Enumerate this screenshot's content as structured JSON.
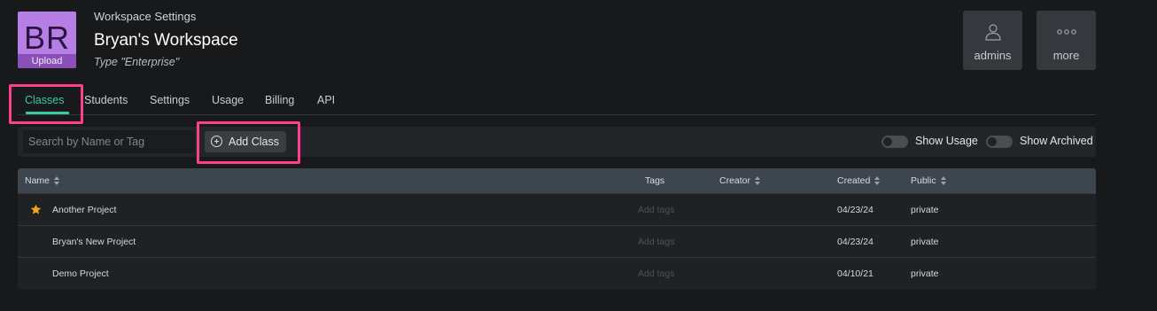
{
  "workspace": {
    "avatar_initials": "BR",
    "upload_label": "Upload",
    "subtitle": "Workspace Settings",
    "title": "Bryan's Workspace",
    "type": "Type \"Enterprise\""
  },
  "top_buttons": {
    "admins": {
      "label": "admins",
      "icon": "user-icon"
    },
    "more": {
      "label": "more",
      "icon": "more-dots-icon"
    }
  },
  "tabs": [
    {
      "label": "Classes",
      "active": true
    },
    {
      "label": "Students",
      "active": false
    },
    {
      "label": "Settings",
      "active": false
    },
    {
      "label": "Usage",
      "active": false
    },
    {
      "label": "Billing",
      "active": false
    },
    {
      "label": "API",
      "active": false
    }
  ],
  "toolbar": {
    "search_placeholder": "Search by Name or Tag",
    "add_class_label": "Add Class",
    "show_usage_label": "Show Usage",
    "show_archived_label": "Show Archived"
  },
  "table": {
    "columns": {
      "name": "Name",
      "tags": "Tags",
      "creator": "Creator",
      "created": "Created",
      "public": "Public"
    },
    "rows": [
      {
        "name": "Another Project",
        "tags": "Add tags",
        "created": "04/23/24",
        "public": "private",
        "starred": true
      },
      {
        "name": "Bryan's New Project",
        "tags": "Add tags",
        "created": "04/23/24",
        "public": "private",
        "starred": false
      },
      {
        "name": "Demo Project",
        "tags": "Add tags",
        "created": "04/10/21",
        "public": "private",
        "starred": false
      }
    ]
  },
  "colors": {
    "accent": "#38c9a6",
    "highlight": "#ff3e8e",
    "avatar": "#b77fe6",
    "star": "#f2a51a"
  }
}
